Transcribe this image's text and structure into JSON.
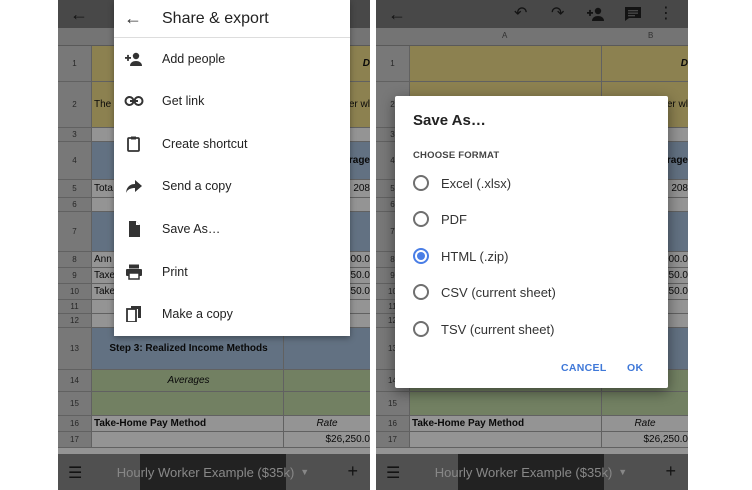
{
  "left_screen": {
    "menu": {
      "title": "Share & export",
      "items": [
        {
          "label": "Add people",
          "icon": "add-person-icon"
        },
        {
          "label": "Get link",
          "icon": "link-icon"
        },
        {
          "label": "Create shortcut",
          "icon": "shortcut-icon"
        },
        {
          "label": "Send a copy",
          "icon": "share-arrow-icon"
        },
        {
          "label": "Save As…",
          "icon": "document-icon"
        },
        {
          "label": "Print",
          "icon": "print-icon"
        },
        {
          "label": "Make a copy",
          "icon": "copy-icon"
        }
      ]
    },
    "sheet": {
      "rows": [
        {
          "n": "1",
          "a": "",
          "b": "D"
        },
        {
          "n": "2",
          "a": "The",
          "b": "er wl"
        },
        {
          "n": "3",
          "a": "",
          "b": ""
        },
        {
          "n": "4",
          "a": "",
          "b": "erage"
        },
        {
          "n": "5",
          "a": "Tota",
          "b": "208"
        },
        {
          "n": "6",
          "a": "",
          "b": ""
        },
        {
          "n": "7",
          "a": "",
          "b": ""
        },
        {
          "n": "8",
          "a": "Ann",
          "b": "000.0"
        },
        {
          "n": "9",
          "a": "Taxe",
          "b": "750.0"
        },
        {
          "n": "10",
          "a": "Take",
          "b": "250.0"
        },
        {
          "n": "11",
          "a": "",
          "b": ""
        },
        {
          "n": "12",
          "a": "",
          "b": ""
        },
        {
          "n": "13",
          "a": "Step 3: Realized Income Methods",
          "b": ""
        },
        {
          "n": "14",
          "a": "Averages",
          "b": ""
        },
        {
          "n": "15",
          "a": "",
          "b": ""
        },
        {
          "n": "16",
          "a": "Take-Home Pay Method",
          "b": "Rate"
        },
        {
          "n": "17",
          "a": "",
          "b": "$26,250.0"
        }
      ],
      "sheet_tab": "Hourly Worker Example ($35k)"
    }
  },
  "right_screen": {
    "sheet": {
      "col_a": "A",
      "col_b": "B",
      "rows": [
        {
          "n": "1",
          "a": "",
          "b": "D"
        },
        {
          "n": "2",
          "a": "",
          "b": "er wl"
        },
        {
          "n": "3",
          "a": "",
          "b": ""
        },
        {
          "n": "4",
          "a": "",
          "b": "erage"
        },
        {
          "n": "5",
          "a": "",
          "b": "208"
        },
        {
          "n": "6",
          "a": "",
          "b": ""
        },
        {
          "n": "7",
          "a": "",
          "b": ""
        },
        {
          "n": "8",
          "a": "",
          "b": "000.0"
        },
        {
          "n": "9",
          "a": "",
          "b": "750.0"
        },
        {
          "n": "10",
          "a": "",
          "b": "250.0"
        },
        {
          "n": "11",
          "a": "",
          "b": ""
        },
        {
          "n": "12",
          "a": "",
          "b": ""
        },
        {
          "n": "13",
          "a": "",
          "b": ""
        },
        {
          "n": "14",
          "a": "",
          "b": ""
        },
        {
          "n": "15",
          "a": "",
          "b": ""
        },
        {
          "n": "16",
          "a": "Take-Home Pay Method",
          "b": "Rate"
        },
        {
          "n": "17",
          "a": "",
          "b": "$26,250.0"
        }
      ],
      "sheet_tab": "Hourly Worker Example ($35k)"
    },
    "dialog": {
      "title": "Save As…",
      "subtitle": "CHOOSE FORMAT",
      "options": [
        {
          "label": "Excel (.xlsx)",
          "checked": false
        },
        {
          "label": "PDF",
          "checked": false
        },
        {
          "label": "HTML (.zip)",
          "checked": true
        },
        {
          "label": "CSV (current sheet)",
          "checked": false
        },
        {
          "label": "TSV (current sheet)",
          "checked": false
        }
      ],
      "cancel_label": "CANCEL",
      "ok_label": "OK"
    }
  },
  "colors": {
    "accent_blue": "#4a7ee6",
    "yellow_cell": "#f2de8a",
    "blue_cell": "#a9c3e0",
    "green_cell": "#c4dcaa"
  },
  "icons": {
    "back": "back-arrow-icon",
    "undo": "undo-icon",
    "redo": "redo-icon",
    "add_person": "add-person-icon",
    "comment": "comment-icon",
    "more": "more-vertical-icon",
    "sheets_list": "sheets-list-icon",
    "add_sheet": "plus-icon",
    "tab_dropdown": "dropdown-triangle-icon"
  }
}
